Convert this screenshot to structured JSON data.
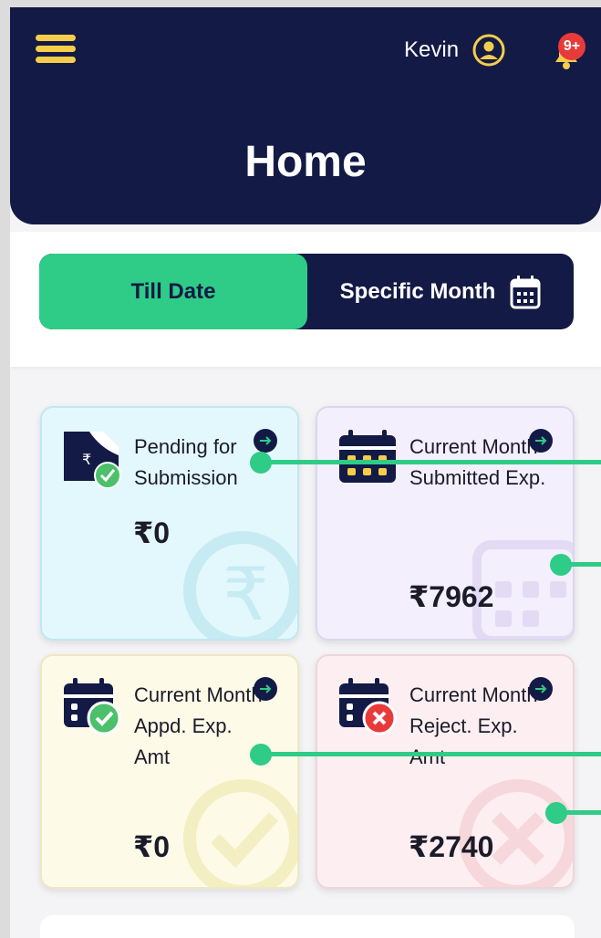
{
  "header": {
    "user_name": "Kevin",
    "notification_badge": "9+",
    "title": "Home"
  },
  "period_toggle": {
    "selected": "Till Date",
    "options": [
      "Till Date",
      "Specific Month"
    ]
  },
  "cards": [
    {
      "label": "Pending for Submission",
      "amount": "₹0",
      "icon": "document-rupee-check-icon",
      "color": "#e3f8fd"
    },
    {
      "label": "Current Month Submitted Exp.",
      "amount": "₹7962",
      "icon": "calendar-icon",
      "color": "#f3effc"
    },
    {
      "label": "Current Month Appd. Exp. Amt",
      "amount": "₹0",
      "icon": "calendar-check-icon",
      "color": "#fdfbe7"
    },
    {
      "label": "Current Month Reject. Exp. Amt",
      "amount": "₹2740",
      "icon": "calendar-cross-icon",
      "color": "#fdeff1"
    }
  ],
  "colors": {
    "navy": "#131a45",
    "accent_green": "#2ecc86",
    "menu_yellow": "#f5cd4a",
    "badge_red": "#e93a3a"
  }
}
